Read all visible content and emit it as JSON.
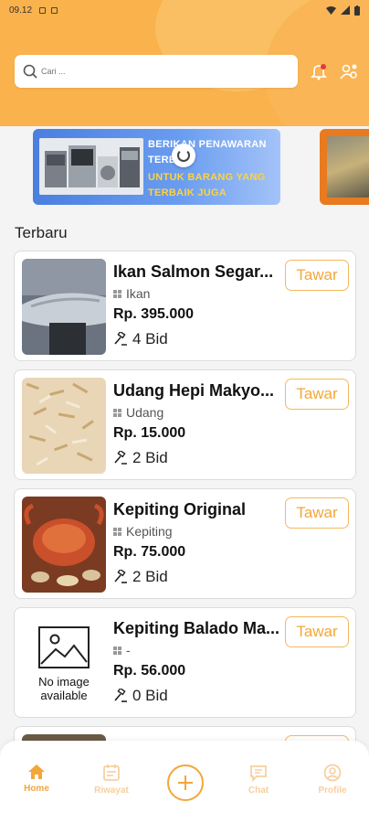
{
  "status_bar": {
    "time": "09.12"
  },
  "search": {
    "placeholder": "Cari ..."
  },
  "banner": {
    "line1": "BERIKAN PENAWARAN",
    "line2": "TERBAIK",
    "line3": "UNTUK BARANG YANG",
    "line4": "TERBAIK JUGA"
  },
  "section_title": "Terbaru",
  "products": [
    {
      "name": "Ikan Salmon Segar...",
      "category": "Ikan",
      "price": "Rp. 395.000",
      "bids": "4 Bid",
      "offer_label": "Tawar"
    },
    {
      "name": "Udang Hepi Makyo...",
      "category": "Udang",
      "price": "Rp. 15.000",
      "bids": "2 Bid",
      "offer_label": "Tawar"
    },
    {
      "name": "Kepiting Original",
      "category": "Kepiting",
      "price": "Rp. 75.000",
      "bids": "2 Bid",
      "offer_label": "Tawar"
    },
    {
      "name": "Kepiting Balado Ma...",
      "category": "-",
      "price": "Rp. 56.000",
      "bids": "0 Bid",
      "offer_label": "Tawar",
      "image_placeholder": "No image available"
    }
  ],
  "nav": {
    "home": "Home",
    "history": "Riwayat",
    "chat": "Chat",
    "profile": "Profile"
  },
  "colors": {
    "accent": "#f2a73a",
    "header": "#f9b24c",
    "banner_blue": "#4a7fe0"
  }
}
